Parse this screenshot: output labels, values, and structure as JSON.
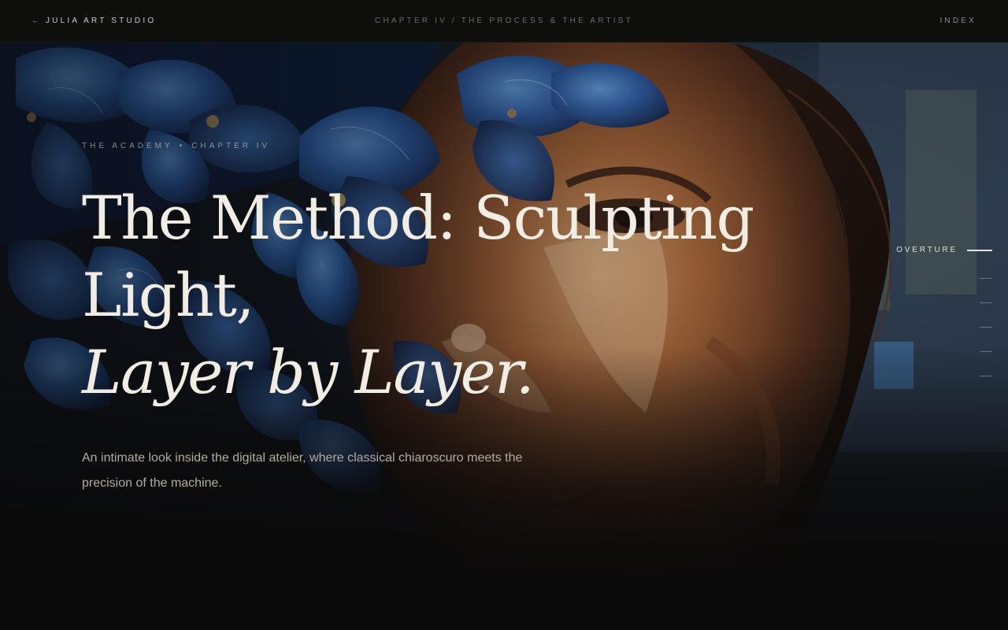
{
  "topbar": {
    "back_arrow": "←",
    "studio_name": "Julia Art Studio",
    "chapter_crumb": "Chapter IV / The Process & The Artist",
    "index_label": "Index"
  },
  "hero": {
    "eyebrow_left": "The Academy",
    "eyebrow_separator": "•",
    "eyebrow_right": "Chapter IV",
    "headline_line1": "The Method: Sculpting",
    "headline_line2": "Light,",
    "headline_line3": "Layer by Layer.",
    "lede": "An intimate look inside the digital atelier, where classical chiaroscuro meets the precision of the machine."
  },
  "section_nav": {
    "active_label": "Overture",
    "sections_count": 6
  },
  "colors": {
    "background": "#0b0a0a",
    "headline": "#f1ece4",
    "body_text": "#b3aca2",
    "flower_blue": "#2f5f9e",
    "skin_ochre": "#b9784a"
  },
  "artwork": {
    "icon": "painting-portrait-with-blue-flowers"
  }
}
